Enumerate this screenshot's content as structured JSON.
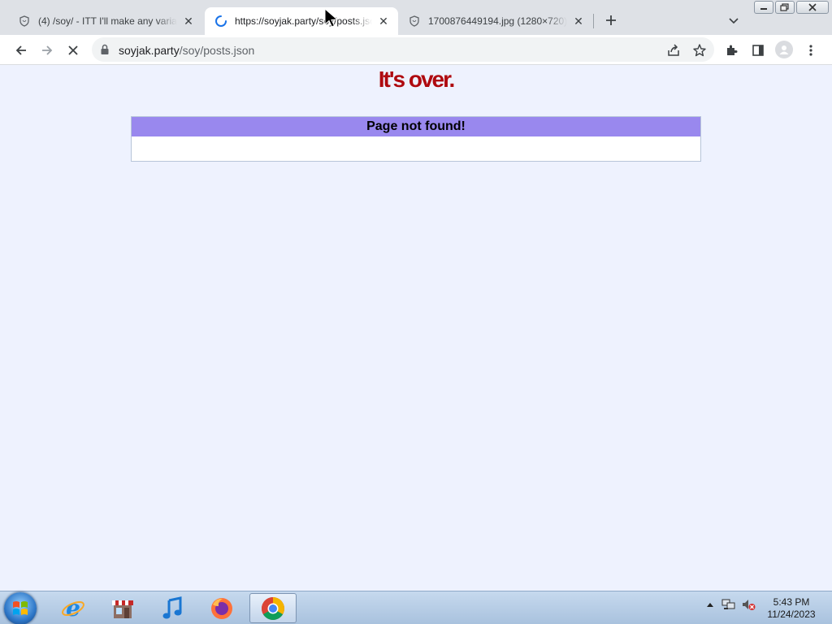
{
  "browser": {
    "tabs": [
      {
        "title": "(4) /soy/ - ITT I'll make any variant",
        "favicon": "shield-favicon",
        "active": false
      },
      {
        "title": "https://soyjak.party/soy/posts.json",
        "favicon": "loading-spinner",
        "active": true
      },
      {
        "title": "1700876449194.jpg (1280×720)",
        "favicon": "shield-favicon",
        "active": false
      }
    ],
    "close_glyph": "✕",
    "newtab_glyph": "+",
    "address": {
      "host": "soyjak.party",
      "path": "/soy/posts.json"
    }
  },
  "page": {
    "title": "It's over.",
    "error_header": "Page not found!",
    "title_color": "#af0a0f",
    "header_color": "#9988ee",
    "background": "#eef2fe"
  },
  "taskbar": {
    "apps": [
      "internet-explorer-icon",
      "store-icon",
      "music-icon",
      "firefox-icon",
      "chrome-icon"
    ],
    "clock_time": "5:43 PM",
    "clock_date": "11/24/2023"
  }
}
